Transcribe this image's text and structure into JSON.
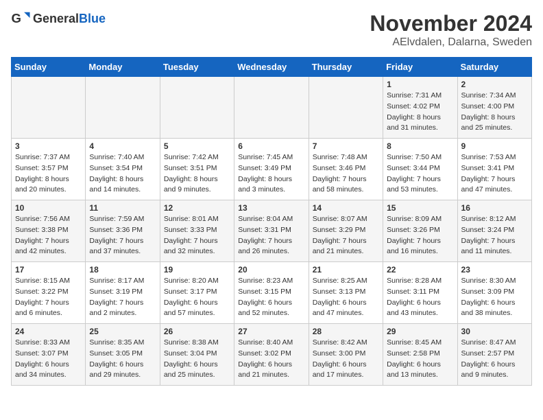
{
  "header": {
    "logo_general": "General",
    "logo_blue": "Blue",
    "title": "November 2024",
    "subtitle": "AElvdalen, Dalarna, Sweden"
  },
  "days_of_week": [
    "Sunday",
    "Monday",
    "Tuesday",
    "Wednesday",
    "Thursday",
    "Friday",
    "Saturday"
  ],
  "weeks": [
    [
      {
        "day": "",
        "details": ""
      },
      {
        "day": "",
        "details": ""
      },
      {
        "day": "",
        "details": ""
      },
      {
        "day": "",
        "details": ""
      },
      {
        "day": "",
        "details": ""
      },
      {
        "day": "1",
        "details": "Sunrise: 7:31 AM\nSunset: 4:02 PM\nDaylight: 8 hours and 31 minutes."
      },
      {
        "day": "2",
        "details": "Sunrise: 7:34 AM\nSunset: 4:00 PM\nDaylight: 8 hours and 25 minutes."
      }
    ],
    [
      {
        "day": "3",
        "details": "Sunrise: 7:37 AM\nSunset: 3:57 PM\nDaylight: 8 hours and 20 minutes."
      },
      {
        "day": "4",
        "details": "Sunrise: 7:40 AM\nSunset: 3:54 PM\nDaylight: 8 hours and 14 minutes."
      },
      {
        "day": "5",
        "details": "Sunrise: 7:42 AM\nSunset: 3:51 PM\nDaylight: 8 hours and 9 minutes."
      },
      {
        "day": "6",
        "details": "Sunrise: 7:45 AM\nSunset: 3:49 PM\nDaylight: 8 hours and 3 minutes."
      },
      {
        "day": "7",
        "details": "Sunrise: 7:48 AM\nSunset: 3:46 PM\nDaylight: 7 hours and 58 minutes."
      },
      {
        "day": "8",
        "details": "Sunrise: 7:50 AM\nSunset: 3:44 PM\nDaylight: 7 hours and 53 minutes."
      },
      {
        "day": "9",
        "details": "Sunrise: 7:53 AM\nSunset: 3:41 PM\nDaylight: 7 hours and 47 minutes."
      }
    ],
    [
      {
        "day": "10",
        "details": "Sunrise: 7:56 AM\nSunset: 3:38 PM\nDaylight: 7 hours and 42 minutes."
      },
      {
        "day": "11",
        "details": "Sunrise: 7:59 AM\nSunset: 3:36 PM\nDaylight: 7 hours and 37 minutes."
      },
      {
        "day": "12",
        "details": "Sunrise: 8:01 AM\nSunset: 3:33 PM\nDaylight: 7 hours and 32 minutes."
      },
      {
        "day": "13",
        "details": "Sunrise: 8:04 AM\nSunset: 3:31 PM\nDaylight: 7 hours and 26 minutes."
      },
      {
        "day": "14",
        "details": "Sunrise: 8:07 AM\nSunset: 3:29 PM\nDaylight: 7 hours and 21 minutes."
      },
      {
        "day": "15",
        "details": "Sunrise: 8:09 AM\nSunset: 3:26 PM\nDaylight: 7 hours and 16 minutes."
      },
      {
        "day": "16",
        "details": "Sunrise: 8:12 AM\nSunset: 3:24 PM\nDaylight: 7 hours and 11 minutes."
      }
    ],
    [
      {
        "day": "17",
        "details": "Sunrise: 8:15 AM\nSunset: 3:22 PM\nDaylight: 7 hours and 6 minutes."
      },
      {
        "day": "18",
        "details": "Sunrise: 8:17 AM\nSunset: 3:19 PM\nDaylight: 7 hours and 2 minutes."
      },
      {
        "day": "19",
        "details": "Sunrise: 8:20 AM\nSunset: 3:17 PM\nDaylight: 6 hours and 57 minutes."
      },
      {
        "day": "20",
        "details": "Sunrise: 8:23 AM\nSunset: 3:15 PM\nDaylight: 6 hours and 52 minutes."
      },
      {
        "day": "21",
        "details": "Sunrise: 8:25 AM\nSunset: 3:13 PM\nDaylight: 6 hours and 47 minutes."
      },
      {
        "day": "22",
        "details": "Sunrise: 8:28 AM\nSunset: 3:11 PM\nDaylight: 6 hours and 43 minutes."
      },
      {
        "day": "23",
        "details": "Sunrise: 8:30 AM\nSunset: 3:09 PM\nDaylight: 6 hours and 38 minutes."
      }
    ],
    [
      {
        "day": "24",
        "details": "Sunrise: 8:33 AM\nSunset: 3:07 PM\nDaylight: 6 hours and 34 minutes."
      },
      {
        "day": "25",
        "details": "Sunrise: 8:35 AM\nSunset: 3:05 PM\nDaylight: 6 hours and 29 minutes."
      },
      {
        "day": "26",
        "details": "Sunrise: 8:38 AM\nSunset: 3:04 PM\nDaylight: 6 hours and 25 minutes."
      },
      {
        "day": "27",
        "details": "Sunrise: 8:40 AM\nSunset: 3:02 PM\nDaylight: 6 hours and 21 minutes."
      },
      {
        "day": "28",
        "details": "Sunrise: 8:42 AM\nSunset: 3:00 PM\nDaylight: 6 hours and 17 minutes."
      },
      {
        "day": "29",
        "details": "Sunrise: 8:45 AM\nSunset: 2:58 PM\nDaylight: 6 hours and 13 minutes."
      },
      {
        "day": "30",
        "details": "Sunrise: 8:47 AM\nSunset: 2:57 PM\nDaylight: 6 hours and 9 minutes."
      }
    ]
  ]
}
